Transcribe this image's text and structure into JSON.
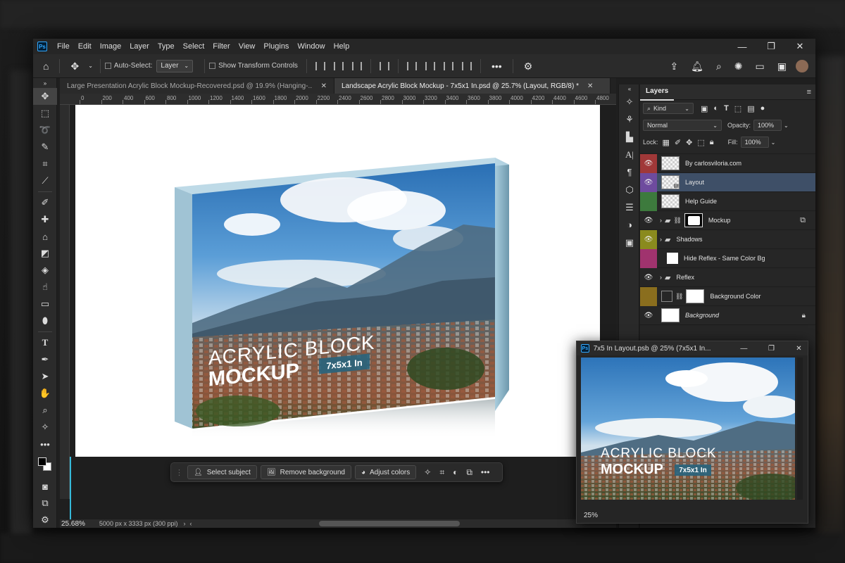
{
  "app": {
    "accent": "#31a8ff",
    "logo": "Ps"
  },
  "menu": {
    "items": [
      "File",
      "Edit",
      "Image",
      "Layer",
      "Type",
      "Select",
      "Filter",
      "View",
      "Plugins",
      "Window",
      "Help"
    ],
    "controls": [
      "minimize-icon",
      "restore-icon",
      "close-icon"
    ]
  },
  "options": {
    "auto_select_label": "Auto-Select:",
    "auto_select_value": "Layer",
    "transform_label": "Show Transform Controls",
    "more_label": "•••"
  },
  "tabs": [
    {
      "title": "Large Presentation Acrylic Block Mockup-Recovered.psd @ 19.9% (Hanging-...",
      "active": false
    },
    {
      "title": "Landscape Acrylic Block Mockup - 7x5x1 In.psd @ 25.7% (Layout, RGB/8) *",
      "active": true
    }
  ],
  "ruler": {
    "labels": [
      "0",
      "200",
      "400",
      "600",
      "800",
      "1000",
      "1200",
      "1400",
      "1600",
      "1800",
      "2000",
      "2200",
      "2400",
      "2600",
      "2800",
      "3000",
      "3200",
      "3400",
      "3600",
      "3800",
      "4000",
      "4200",
      "4400",
      "4600",
      "4800"
    ]
  },
  "mockup": {
    "line1": "ACRYLIC BLOCK",
    "line2": "MOCKUP",
    "badge": "7x5x1 In"
  },
  "context_bar": {
    "select_subject": "Select subject",
    "remove_background": "Remove background",
    "adjust_colors": "Adjust colors",
    "more": "•••"
  },
  "status": {
    "zoom": "25.68%",
    "doc_info": "5000 px x 3333 px (300 ppi)"
  },
  "layers_panel": {
    "title": "Layers",
    "filter_kind": "Kind",
    "blend_mode": "Normal",
    "opacity_label": "Opacity:",
    "opacity_value": "100%",
    "lock_label": "Lock:",
    "fill_label": "Fill:",
    "fill_value": "100%",
    "layers": [
      {
        "name": "By carlosviloria.com",
        "color": "#a03838",
        "visible": true,
        "selected": false,
        "type": "layer"
      },
      {
        "name": "Layout",
        "color": "#6e4b9e",
        "visible": true,
        "selected": true,
        "type": "smart"
      },
      {
        "name": "Help Guide",
        "color": "#3d7a3d",
        "visible": false,
        "selected": false,
        "type": "layer"
      },
      {
        "name": "Mockup",
        "color": "",
        "visible": true,
        "selected": false,
        "type": "group-mask"
      },
      {
        "name": "Shadows",
        "color": "#8a8a1e",
        "visible": true,
        "selected": false,
        "type": "group"
      },
      {
        "name": "Hide Reflex - Same Color Bg",
        "color": "#a0336e",
        "visible": false,
        "selected": false,
        "type": "layer-white"
      },
      {
        "name": "Reflex",
        "color": "",
        "visible": true,
        "selected": false,
        "type": "group"
      },
      {
        "name": "Background Color",
        "color": "#8a6e1e",
        "visible": false,
        "selected": false,
        "type": "fill"
      },
      {
        "name": "Background",
        "color": "",
        "visible": true,
        "selected": false,
        "type": "background"
      }
    ]
  },
  "float_window": {
    "title": "7x5 In Layout.psb @ 25% (7x5x1 In...",
    "zoom": "25%",
    "line1": "ACRYLIC BLOCK",
    "line2": "MOCKUP",
    "badge": "7x5x1 In"
  }
}
